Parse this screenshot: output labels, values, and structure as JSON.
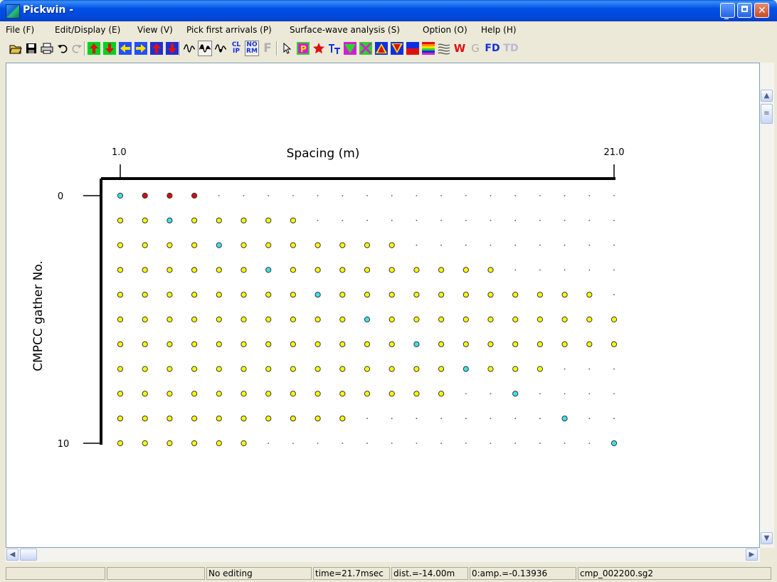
{
  "window": {
    "title": "Pickwin -"
  },
  "menu": [
    "File (F)",
    "Edit/Display (E)",
    "View (V)",
    "Pick first arrivals (P)",
    "Surface-wave analysis (S)",
    "Option (O)",
    "Help (H)"
  ],
  "toolbar_icons": [
    "open-icon",
    "save-icon",
    "print-icon",
    "undo-icon",
    "redo-icon",
    "red-up-arrow-icon",
    "red-down-arrow-icon",
    "left-arrow-icon",
    "right-arrow-icon",
    "blue-up-arrow-icon",
    "blue-down-arrow-icon",
    "wiggle-trace-icon",
    "variable-area-icon",
    "wiggle-negative-icon",
    "clip-icon",
    "normalize-icon",
    "filter-icon",
    "pointer-icon",
    "pick-icon",
    "star-icon",
    "text-size-icon",
    "triangle-down-green-icon",
    "cross-icon",
    "triangle-up-icon",
    "triangle-down-icon",
    "color-bar-icon",
    "rainbow-icon",
    "contour-icon",
    "w-icon",
    "g-icon",
    "fd-icon",
    "td-icon"
  ],
  "toolbar_text": {
    "clip": [
      "CL",
      "IP"
    ],
    "normalize": [
      "NO",
      "RM"
    ],
    "filter": "F",
    "pick": "P",
    "w": "W",
    "g": "G",
    "fd": "FD",
    "td": "TD"
  },
  "plot": {
    "x_min_label": "1.0",
    "x_max_label": "21.0",
    "x_axis_title": "Spacing (m)",
    "y_axis_title": "CMPCC gather No.",
    "y_labels": [
      "0",
      "10"
    ],
    "colors": {
      "cyan": "#40e0e8",
      "yellow": "#ffff00",
      "red": "#d01010",
      "axis": "#000000"
    },
    "rows": [
      "CRRR.....................",
      "YYCYYYYY.............",
      "YYYYCYYYYYYY.........",
      "YYYYYYCYYYYYYYYY.....",
      "YYYYYYYYCYYYYYYYYYYY.",
      "YYYYYYYYYYCYYYYYYYYYY",
      "YYYYYYYYYYYYCYYYYYYYY",
      "YYYYYYYYYYYYYYCYYY...",
      "YYYYYYYYYYYYYY..C....",
      "YYYYYYYYYY........C..",
      "YYYYYY..............C"
    ]
  },
  "status": {
    "cell0": "",
    "cell1": "",
    "mode": "No editing",
    "time": "time=21.7msec",
    "dist": "dist.=-14.00m",
    "amp": "0:amp.=-0.13936",
    "file": "cmp_002200.sg2"
  }
}
